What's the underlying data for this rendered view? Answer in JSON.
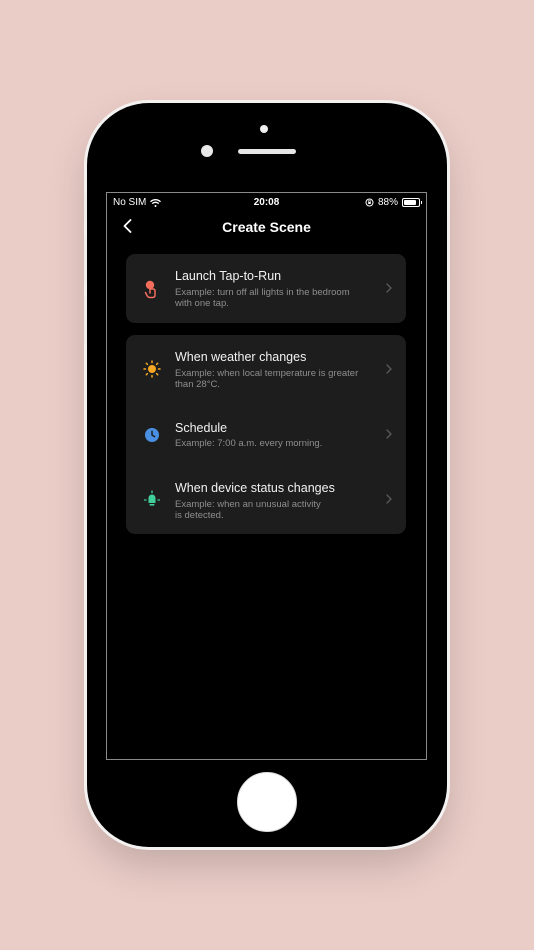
{
  "status_bar": {
    "carrier": "No SIM",
    "time": "20:08",
    "battery_percent": "88%",
    "battery_level": 0.88,
    "icons": [
      "wifi-icon",
      "rotation-lock-icon",
      "battery-icon"
    ]
  },
  "nav": {
    "title": "Create Scene",
    "back_icon": "chevron-left-icon"
  },
  "scenes": [
    {
      "title": "Launch Tap-to-Run",
      "desc_line1": "Example: turn off all lights in the bedroom",
      "desc_line2": "with one tap.",
      "icon": "tap-hand-icon",
      "icon_color": "#f26d5b"
    },
    {
      "title": "When weather changes",
      "desc_line1": "Example: when local temperature is greater",
      "desc_line2": "than 28°C.",
      "icon": "sun-icon",
      "icon_color": "#f5a623"
    },
    {
      "title": "Schedule",
      "desc_line1": "Example: 7:00 a.m. every morning.",
      "desc_line2": "",
      "icon": "clock-icon",
      "icon_color": "#4a90e2"
    },
    {
      "title": "When device status changes",
      "desc_line1": "Example: when an unusual activity",
      "desc_line2": "is detected.",
      "icon": "device-bulb-icon",
      "icon_color": "#3ecf9a"
    }
  ],
  "colors": {
    "background": "#ebcdc7",
    "card": "#1d1d1d",
    "text_primary": "#f2f2f2",
    "text_secondary": "#8e8e8e"
  }
}
